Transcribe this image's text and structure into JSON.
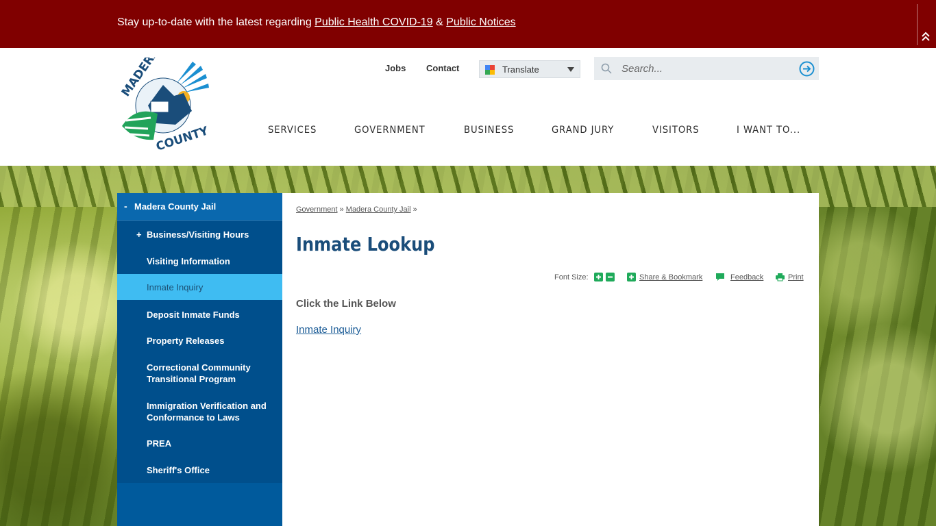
{
  "alert": {
    "text": "Stay up-to-date with  the latest regarding ",
    "link1": "Public Health COVID-19",
    "sep": " & ",
    "link2": "Public Notices"
  },
  "header": {
    "logo_text_top": "MADERA",
    "logo_text_bottom": "COUNTY",
    "jobs": "Jobs",
    "contact": "Contact",
    "translate": "Translate",
    "search_placeholder": "Search..."
  },
  "nav": [
    "SERVICES",
    "GOVERNMENT",
    "BUSINESS",
    "GRAND JURY",
    "VISITORS",
    "I WANT TO..."
  ],
  "sidebar": {
    "top": "Madera County Jail",
    "items": [
      {
        "label": "Business/Visiting Hours",
        "expandable": true
      },
      {
        "label": "Visiting Information"
      },
      {
        "label": "Inmate Inquiry",
        "active": true
      },
      {
        "label": "Deposit Inmate Funds"
      },
      {
        "label": "Property Releases"
      },
      {
        "label": "Correctional Community Transitional Program"
      },
      {
        "label": "Immigration Verification and Conformance to Laws"
      },
      {
        "label": "PREA"
      },
      {
        "label": "Sheriff's Office"
      }
    ]
  },
  "content": {
    "breadcrumb": [
      "Government",
      "Madera County Jail"
    ],
    "breadcrumb_sep": "»",
    "title": "Inmate Lookup",
    "font_size_label": "Font Size:",
    "share": "Share & Bookmark",
    "feedback": "Feedback",
    "print": "Print",
    "instructions": "Click the Link Below",
    "link": "Inmate Inquiry"
  },
  "colors": {
    "alert_bg": "#800000",
    "sidebar_bg": "#005a9c",
    "sidebar_active": "#3fbcf2",
    "title": "#1a4d7a",
    "tool_green": "#1faa5a"
  }
}
